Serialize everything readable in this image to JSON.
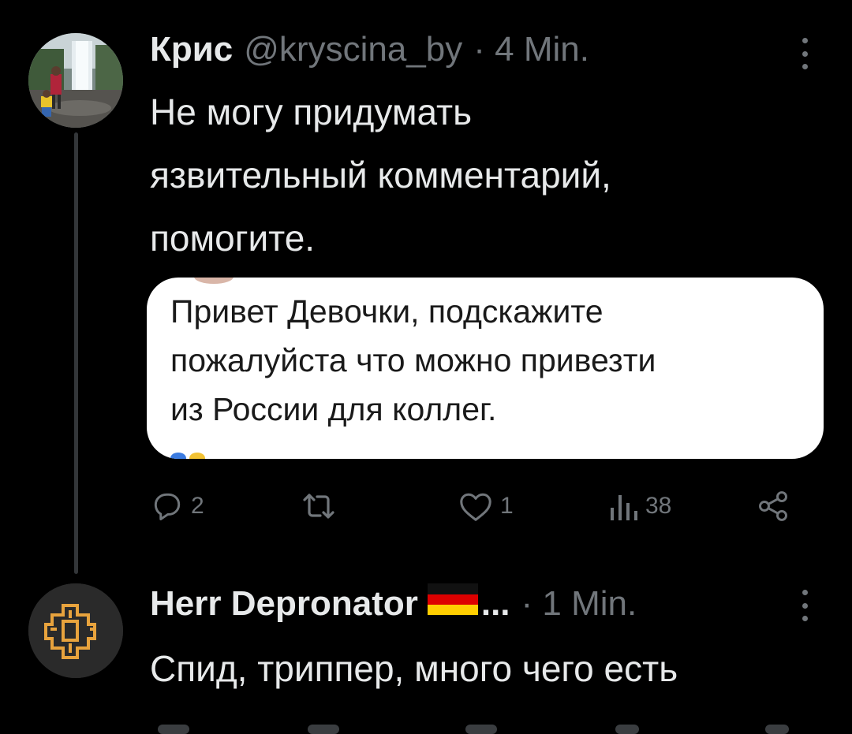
{
  "tweet_1": {
    "display_name": "Крис",
    "handle": "@kryscina_by",
    "time": "· 4 Min.",
    "text": "Не могу придумать\nязвительный комментарий,\nпомогите.",
    "quote_text": "Привет Девочки, подскажите\nпожалуйста что можно привезти\nиз России для коллег.",
    "reply_count": "2",
    "like_count": "1",
    "view_count": "38",
    "icons": [
      "reply-icon",
      "retweet-icon",
      "like-icon",
      "views-icon",
      "share-icon",
      "more-icon"
    ]
  },
  "tweet_2": {
    "display_name": "Herr Depronator",
    "ellipsis": "...",
    "time": "· 1 Min.",
    "text": "Спид, триппер, много чего есть",
    "icons": [
      "germany-flag-icon",
      "rammstein-logo-icon",
      "more-icon"
    ]
  },
  "colors": {
    "background": "#000000",
    "primary_text": "#e7e9ea",
    "secondary_text": "#71767b",
    "thread_line": "#333639",
    "quote_background": "#ffffff",
    "logo_orange": "#e8a33d"
  }
}
